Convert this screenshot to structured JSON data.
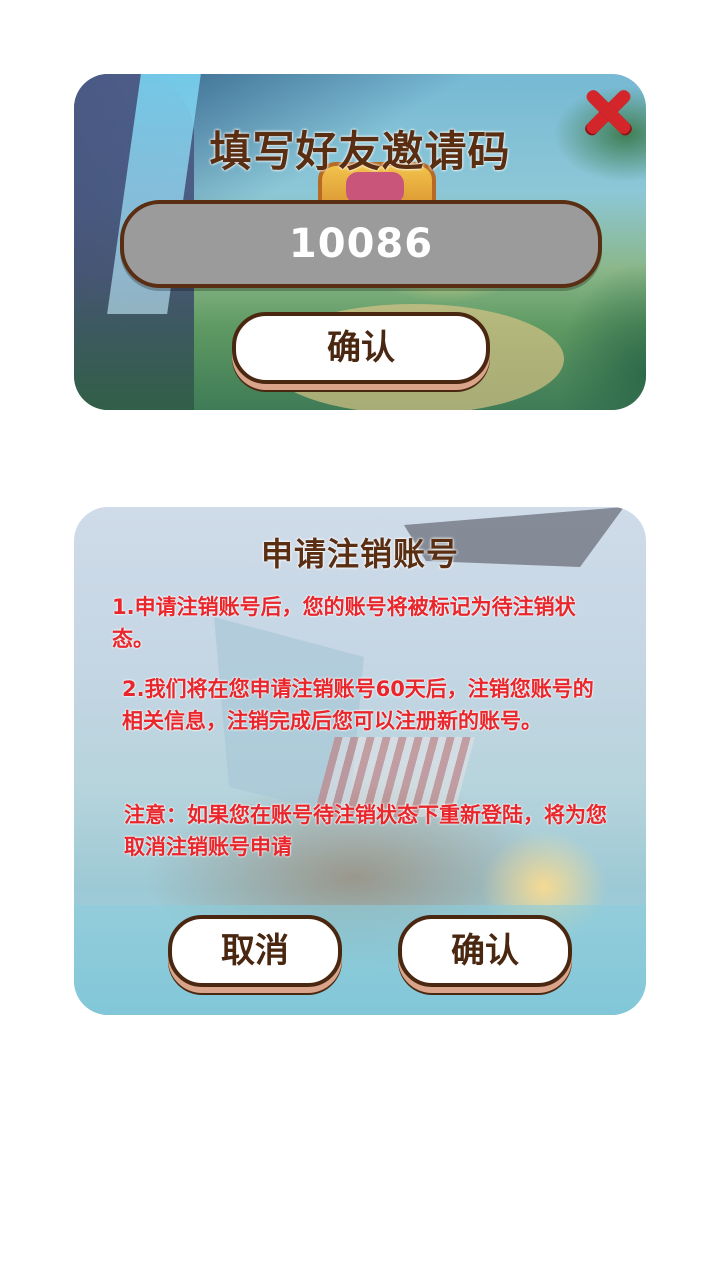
{
  "invite_dialog": {
    "title": "填写好友邀请码",
    "code_value": "10086",
    "confirm_label": "确认"
  },
  "cancel_dialog": {
    "title": "申请注销账号",
    "notice_1": "1.申请注销账号后，您的账号将被标记为待注销状态。",
    "notice_2": "2.我们将在您申请注销账号60天后，注销您账号的相关信息，注销完成后您可以注册新的账号。",
    "notice_3": "注意：如果您在账号待注销状态下重新登陆，将为您取消注销账号申请",
    "cancel_label": "取消",
    "confirm_label": "确认"
  },
  "colors": {
    "title_brown": "#5a2e12",
    "notice_red": "#e8262b",
    "close_red": "#d3262b",
    "field_gray": "#9b9b9b"
  },
  "icons": {
    "close": "close-icon"
  }
}
